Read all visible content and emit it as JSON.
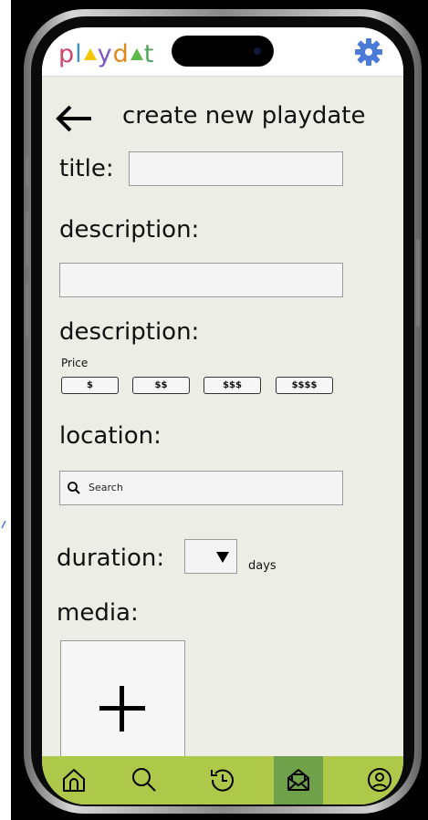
{
  "app": {
    "logo_letters": [
      "p",
      "l",
      "y",
      "d",
      "t"
    ],
    "logo_colors": [
      "#d0466a",
      "#3c8fcf",
      "#7b57c2",
      "#e08a1c",
      "#4fa35b"
    ],
    "accent": "#aec84a",
    "active_nav": "#6fa04a",
    "gear_color": "#4a7bd6"
  },
  "header": {
    "title": "create new playdate",
    "back_icon": "arrow-left-icon"
  },
  "form": {
    "title_label": "title:",
    "title_value": "",
    "description_label": "description:",
    "description_value": "",
    "price_section_label": "description:",
    "price_caption": "Price",
    "price_options": [
      "$",
      "$$",
      "$$$",
      "$$$$"
    ],
    "location_label": "location:",
    "location_placeholder": "Search",
    "duration_label": "duration:",
    "duration_value": "",
    "duration_unit": "days",
    "media_label": "media:"
  },
  "nav": {
    "items": [
      {
        "icon": "home-icon",
        "active": false
      },
      {
        "icon": "search-icon",
        "active": false
      },
      {
        "icon": "history-icon",
        "active": false
      },
      {
        "icon": "inbox-icon",
        "active": true
      },
      {
        "icon": "profile-icon",
        "active": false
      }
    ]
  }
}
